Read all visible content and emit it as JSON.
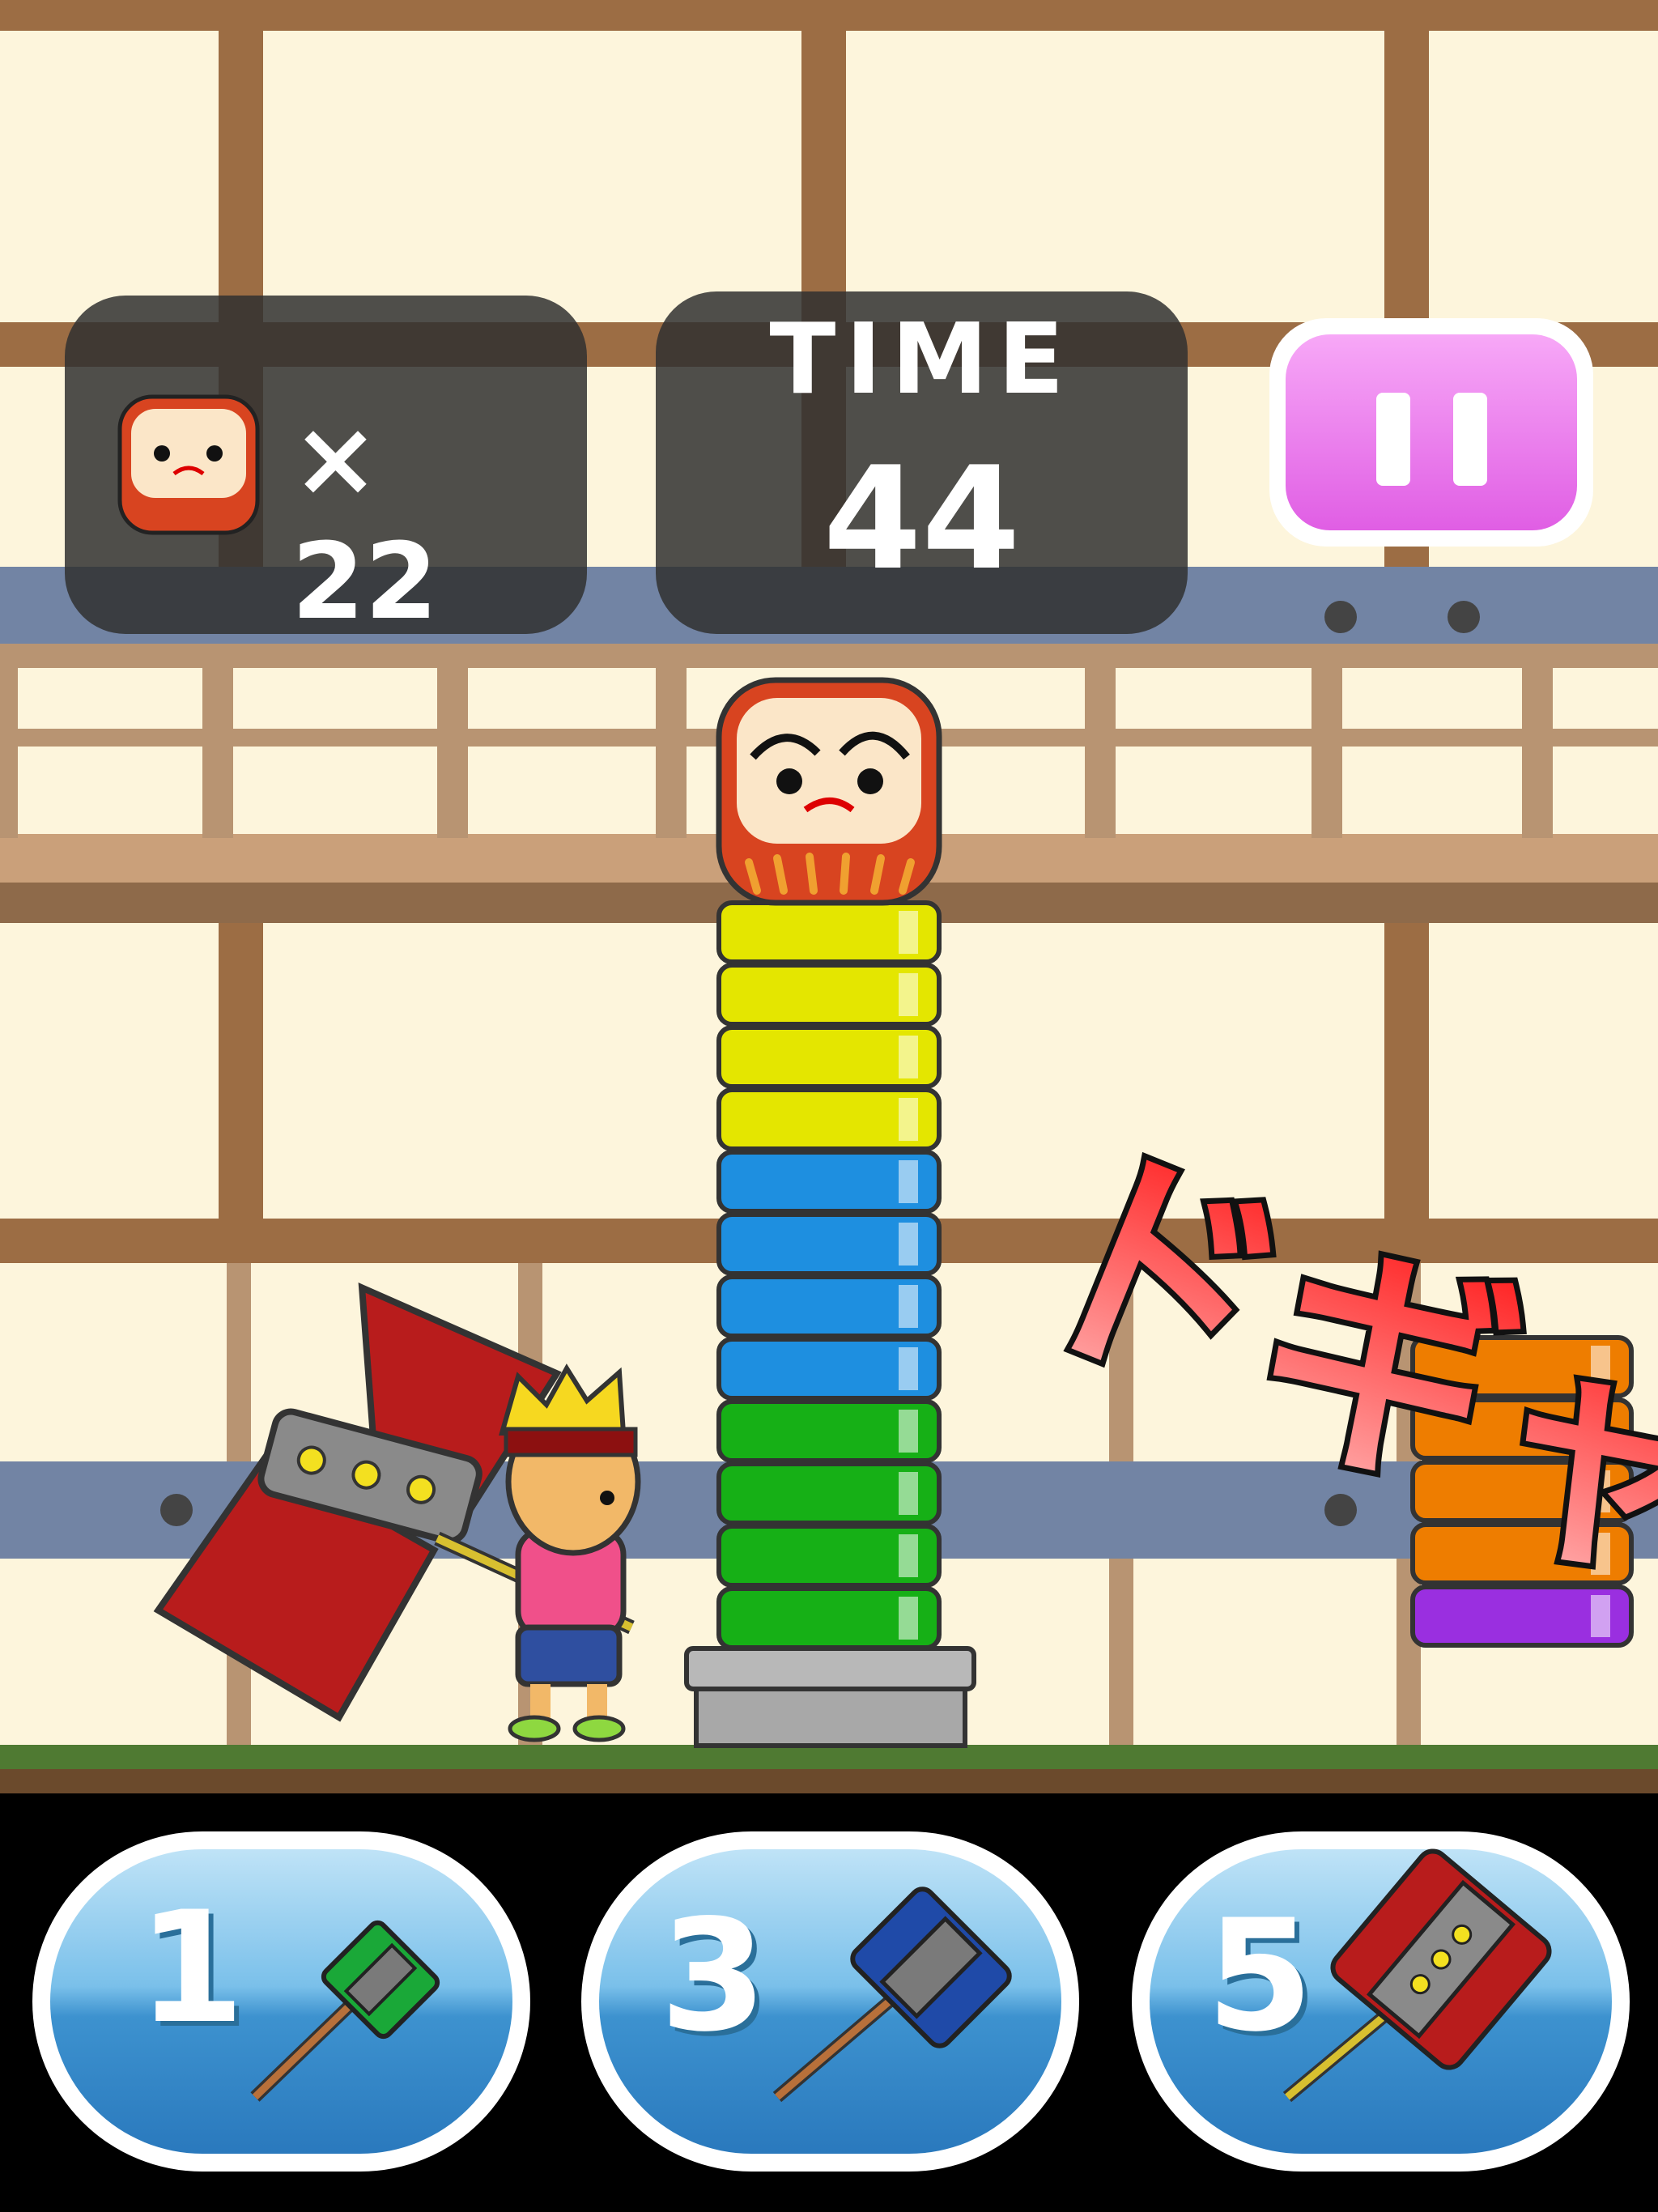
{
  "hud": {
    "daruma_count_label": "× 22",
    "time_label": "TIME",
    "time_value": "44",
    "pause_icon": "pause-icon"
  },
  "effect_text": "ドギャッ",
  "stack_colors": [
    "#e4e600",
    "#e4e600",
    "#e4e600",
    "#e4e600",
    "#1e8fe0",
    "#1e8fe0",
    "#1e8fe0",
    "#1e8fe0",
    "#16b016",
    "#16b016",
    "#16b016",
    "#16b016"
  ],
  "flying_colors": [
    "#ee7d00",
    "#ee7d00",
    "#ee7d00",
    "#ee7d00",
    "#9a2fe0"
  ],
  "hammer_buttons": [
    {
      "label": "1",
      "icon": "green-hammer-icon"
    },
    {
      "label": "3",
      "icon": "blue-hammer-icon"
    },
    {
      "label": "5",
      "icon": "red-hammer-icon"
    }
  ]
}
